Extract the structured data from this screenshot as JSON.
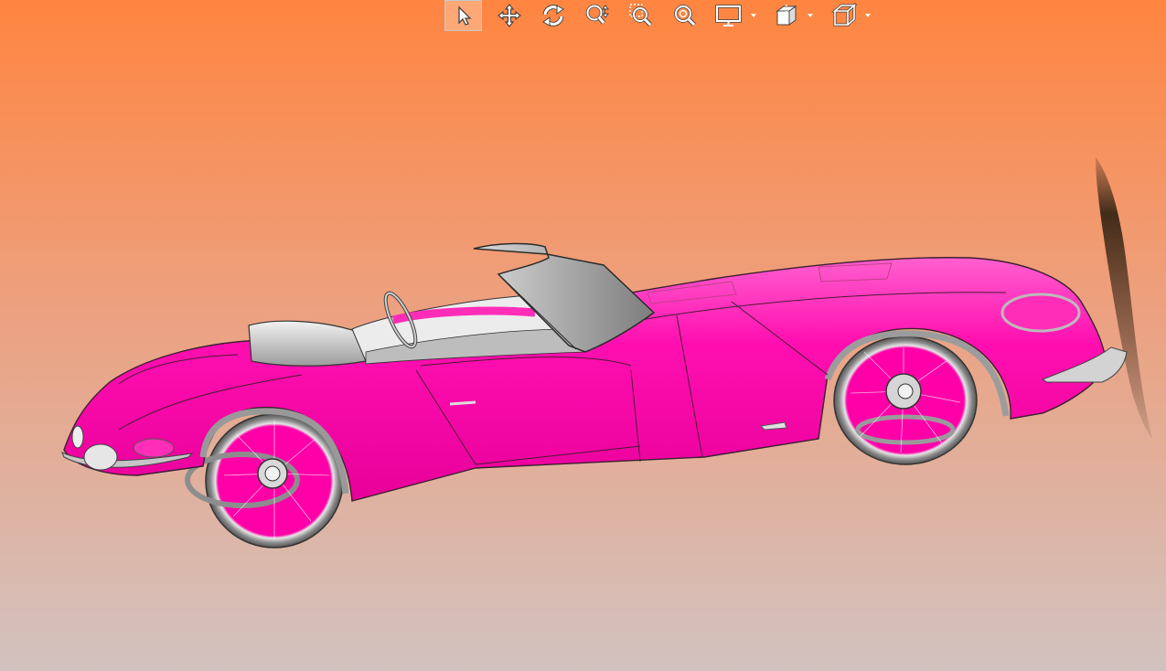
{
  "viewport": {
    "background_top": "#ff8540",
    "background_bottom": "#d4c0bc",
    "model_color": "#ff00a8",
    "trim_color": "#9a9a9a",
    "shadow_color": "#3a2a1e"
  },
  "toolbar": {
    "items": [
      {
        "icon": "select-arrow-icon",
        "active": true,
        "dropdown": false
      },
      {
        "icon": "pan-move-icon",
        "active": false,
        "dropdown": false
      },
      {
        "icon": "rotate-icon",
        "active": false,
        "dropdown": false
      },
      {
        "icon": "zoom-dynamic-icon",
        "active": false,
        "dropdown": false
      },
      {
        "icon": "zoom-window-icon",
        "active": false,
        "dropdown": false
      },
      {
        "icon": "zoom-fit-icon",
        "active": false,
        "dropdown": false
      },
      {
        "icon": "display-mode-icon",
        "active": false,
        "dropdown": true
      },
      {
        "icon": "section-view-icon",
        "active": false,
        "dropdown": true
      },
      {
        "icon": "view-cube-icon",
        "active": false,
        "dropdown": true
      }
    ]
  }
}
